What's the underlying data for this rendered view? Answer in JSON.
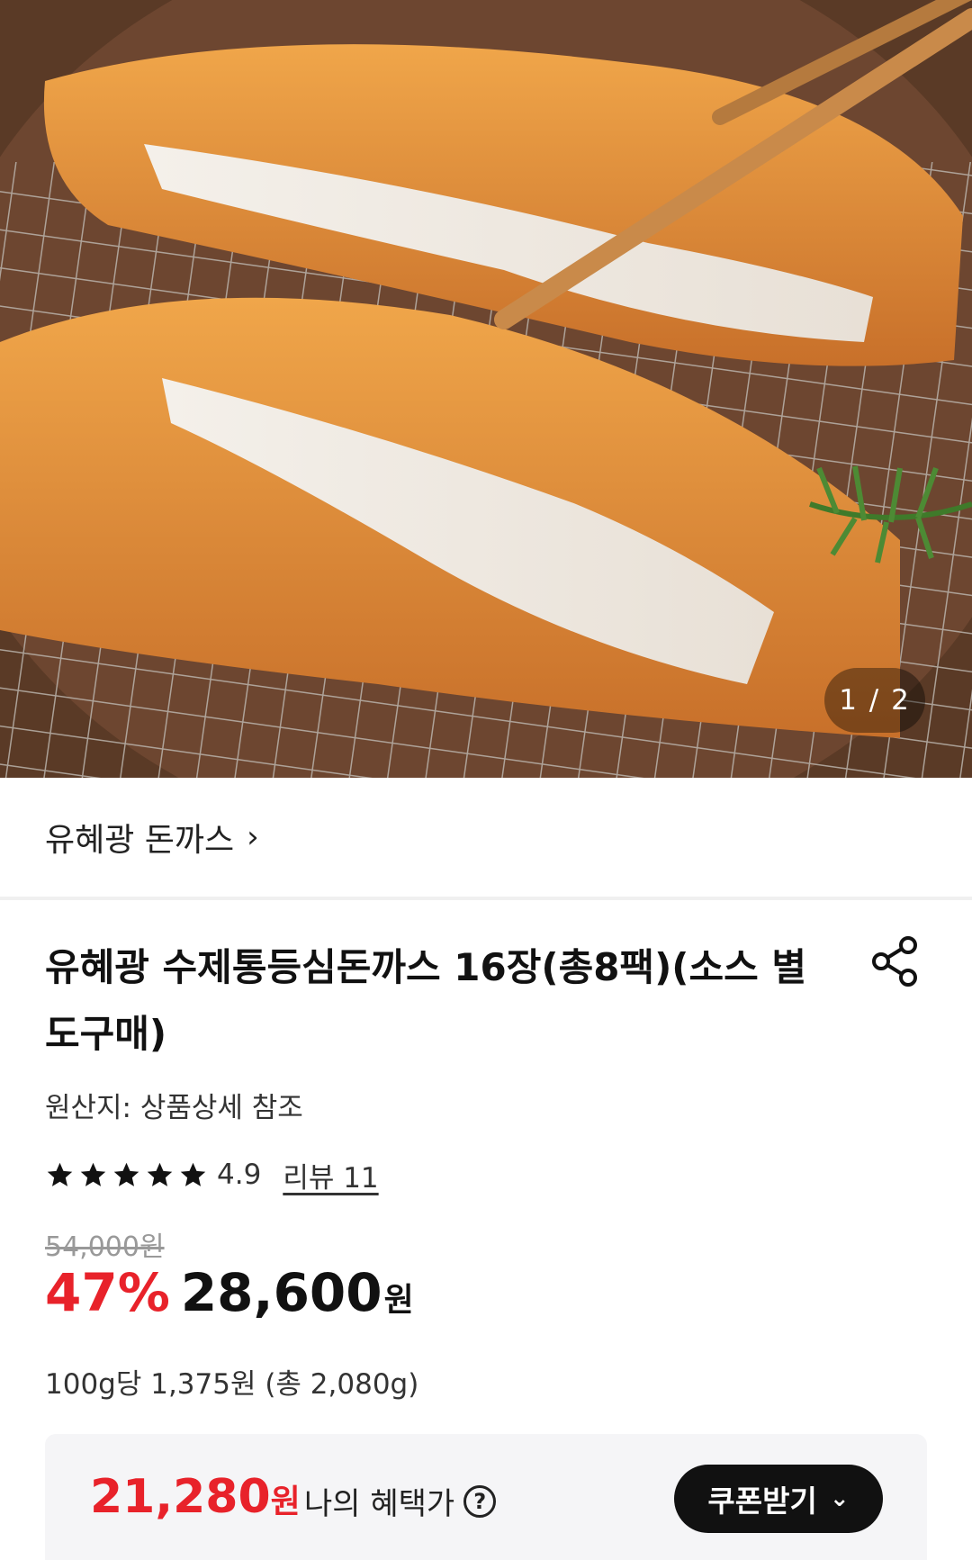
{
  "hero": {
    "pager": "1 / 2",
    "image": "tonkatsu-photo"
  },
  "brand": {
    "name": "유혜광 돈까스",
    "chevron": "›"
  },
  "product": {
    "title": "유혜광 수제통등심돈까스 16장(총8팩)(소스 별도구매)",
    "origin": "원산지: 상품상세 참조",
    "rating": "4.9",
    "star_count": 5,
    "reviews": "리뷰 11",
    "original_price": "54,000원",
    "discount": "47%",
    "price": "28,600",
    "won": "원",
    "unit_price": "100g당 1,375원 (총 2,080g)"
  },
  "benefit": {
    "price": "21,280",
    "won": "원",
    "label": "나의 혜택가",
    "help": "?",
    "coupon_button": "쿠폰받기",
    "coupon_chevron": "⌄"
  },
  "colors": {
    "accent_red": "#e8222a",
    "button_black": "#111111",
    "star": "#111111"
  },
  "icons": [
    "share-icon",
    "star-icon",
    "chevron-right-icon",
    "help-icon",
    "chevron-down-icon"
  ]
}
